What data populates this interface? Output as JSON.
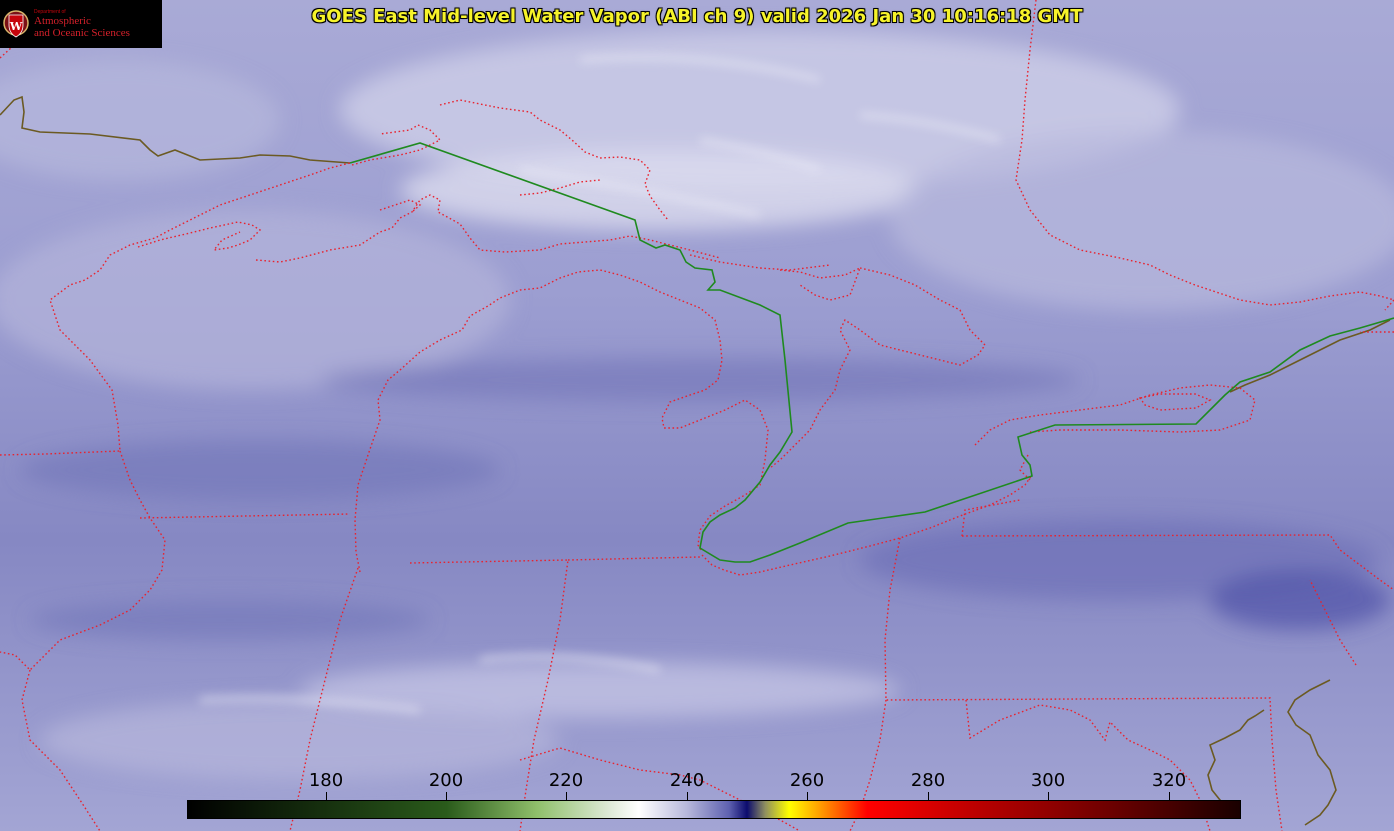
{
  "title": "GOES East Mid-level Water Vapor (ABI ch 9)  valid 2026 Jan 30 10:16:18 GMT",
  "logo": {
    "department": "Department of",
    "line1": "Atmospheric",
    "line2": "and Oceanic Sciences",
    "seal_letter": "W"
  },
  "colorbar": {
    "min": 157,
    "max": 332,
    "ticks": [
      180,
      200,
      220,
      240,
      260,
      280,
      300,
      320
    ],
    "stops": [
      {
        "value": 157,
        "color": "#000000"
      },
      {
        "value": 200,
        "color": "#2a5b1b"
      },
      {
        "value": 215,
        "color": "#8fbf6a"
      },
      {
        "value": 227,
        "color": "#dde9d6"
      },
      {
        "value": 232,
        "color": "#ffffff"
      },
      {
        "value": 240,
        "color": "#b7b8db"
      },
      {
        "value": 247,
        "color": "#5e61b0"
      },
      {
        "value": 250,
        "color": "#0c0c6e"
      },
      {
        "value": 253,
        "color": "#8f8f60"
      },
      {
        "value": 257,
        "color": "#ffff00"
      },
      {
        "value": 262,
        "color": "#ffa000"
      },
      {
        "value": 270,
        "color": "#ff0000"
      },
      {
        "value": 290,
        "color": "#b40000"
      },
      {
        "value": 310,
        "color": "#6e0000"
      },
      {
        "value": 332,
        "color": "#1a0000"
      }
    ]
  },
  "colors": {
    "border_political": "#e8232f",
    "border_international": "#1f8a1f",
    "coast": "#6b5a22",
    "title_text": "#f6f32a"
  }
}
